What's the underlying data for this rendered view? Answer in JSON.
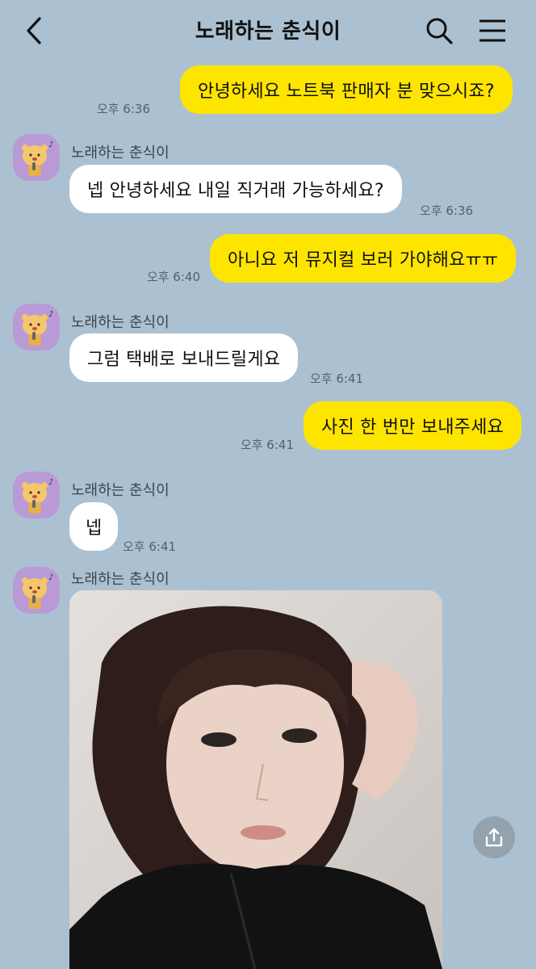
{
  "header": {
    "title": "노래하는 춘식이",
    "icons": {
      "back": "chevron-left-icon",
      "search": "search-icon",
      "menu": "hamburger-menu-icon"
    }
  },
  "messages": [
    {
      "from": "me",
      "text": "안녕하세요 노트북 판매자 분 맞으시죠?",
      "time": "오후 6:36"
    },
    {
      "from": "other",
      "sender": "노래하는 춘식이",
      "text": "넵 안녕하세요 내일 직거래 가능하세요?",
      "time": "오후 6:36"
    },
    {
      "from": "me",
      "text": "아니요 저 뮤지컬 보러 가야해요ㅠㅠ",
      "time": "오후 6:40"
    },
    {
      "from": "other",
      "sender": "노래하는 춘식이",
      "text": "그럼 택배로 보내드릴게요",
      "time": "오후 6:41"
    },
    {
      "from": "me",
      "text": "사진 한 번만 보내주세요",
      "time": "오후 6:41"
    },
    {
      "from": "other",
      "sender": "노래하는 춘식이",
      "text": "넵",
      "time": "오후 6:41"
    },
    {
      "from": "other",
      "sender": "노래하는 춘식이",
      "type": "photo"
    }
  ],
  "colors": {
    "background": "#abc1d1",
    "my_bubble": "#fee500",
    "their_bubble": "#ffffff",
    "avatar_bg": "#b99ad6"
  },
  "share_icon": "share-icon"
}
